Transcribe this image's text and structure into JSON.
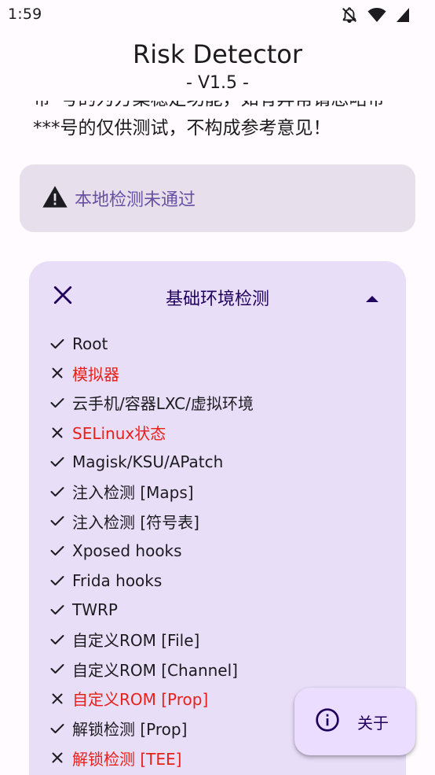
{
  "status_bar": {
    "time": "1:59",
    "icons": [
      "notifications-off-icon",
      "wifi-icon",
      "cellular-signal-icon"
    ]
  },
  "app": {
    "title": "Risk Detector",
    "version": "- V1.5 -"
  },
  "intro": {
    "text_partial": "带*号的为方案稳定功能，如有异常请忽略带***号的仅供测试，不构成参考意见！"
  },
  "alert": {
    "icon": "warning-icon",
    "text": "本地检测未通过"
  },
  "section": {
    "status_icon": "close-icon",
    "title": "基础环境检测",
    "collapse_icon": "arrow-up-icon",
    "items": [
      {
        "label": "Root",
        "passed": true
      },
      {
        "label": "模拟器",
        "passed": false
      },
      {
        "label": "云手机/容器LXC/虚拟环境",
        "passed": true
      },
      {
        "label": "SELinux状态",
        "passed": false
      },
      {
        "label": "Magisk/KSU/APatch",
        "passed": true
      },
      {
        "label": "注入检测 [Maps]",
        "passed": true
      },
      {
        "label": "注入检测 [符号表]",
        "passed": true
      },
      {
        "label": "Xposed hooks",
        "passed": true
      },
      {
        "label": "Frida hooks",
        "passed": true
      },
      {
        "label": "TWRP",
        "passed": true
      },
      {
        "label": "自定义ROM [File]",
        "passed": true
      },
      {
        "label": "自定义ROM [Channel]",
        "passed": true
      },
      {
        "label": "自定义ROM [Prop]",
        "passed": false
      },
      {
        "label": "解锁检测 [Prop]",
        "passed": true
      },
      {
        "label": "解锁检测 [TEE]",
        "passed": false
      }
    ]
  },
  "fab": {
    "icon": "info-icon",
    "label": "关于"
  },
  "colors": {
    "background": "#FFFBFE",
    "alert_bg": "#E7E0EC",
    "alert_text": "#6750A4",
    "card_bg": "#E8DEF8",
    "card_title": "#21005D",
    "fail": "#E8201A",
    "fab_bg": "#EADDFF"
  }
}
